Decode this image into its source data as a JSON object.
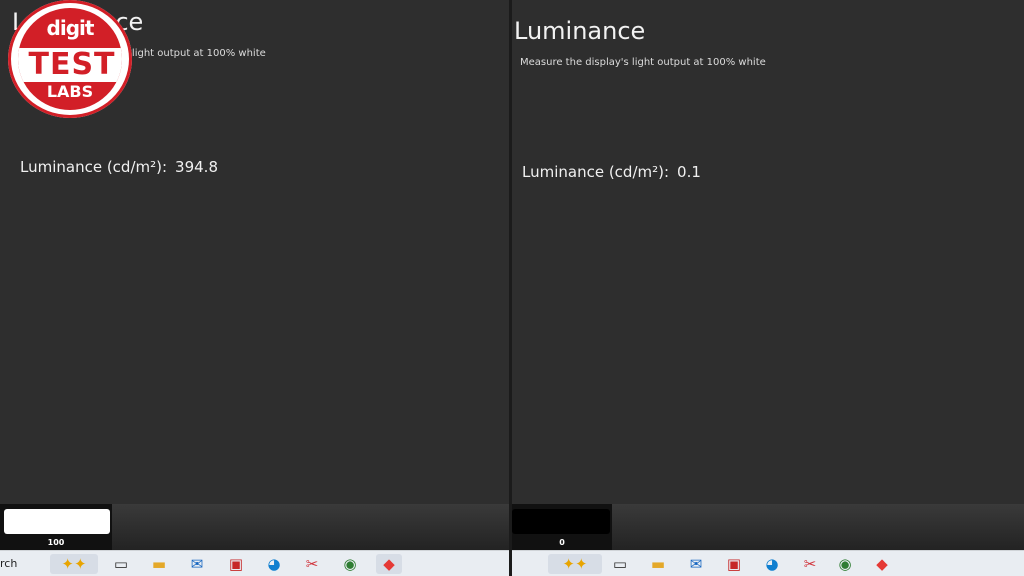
{
  "left": {
    "heading": "Luminance",
    "subtitle": "Measure the display's light output at 100% white",
    "readout_label": "Luminance (cd/m²):",
    "readout_value": "394.8",
    "swatch_value": "100",
    "swatch_color": "#ffffff"
  },
  "right": {
    "heading": "Luminance",
    "subtitle": "Measure the display's light output at 100% white",
    "readout_label": "Luminance (cd/m²):",
    "readout_value": "0.1",
    "swatch_value": "0",
    "swatch_color": "#000000"
  },
  "logo": {
    "line1": "digit",
    "line2": "TEST",
    "line3": "LABS"
  },
  "taskbar": {
    "search_text": "rch",
    "icons": [
      "copilot-sparkle-icon",
      "task-view-icon",
      "file-explorer-icon",
      "outlook-icon",
      "gift-app-icon",
      "edge-icon",
      "snipping-tool-icon",
      "chrome-icon",
      "calibration-app-icon"
    ]
  }
}
